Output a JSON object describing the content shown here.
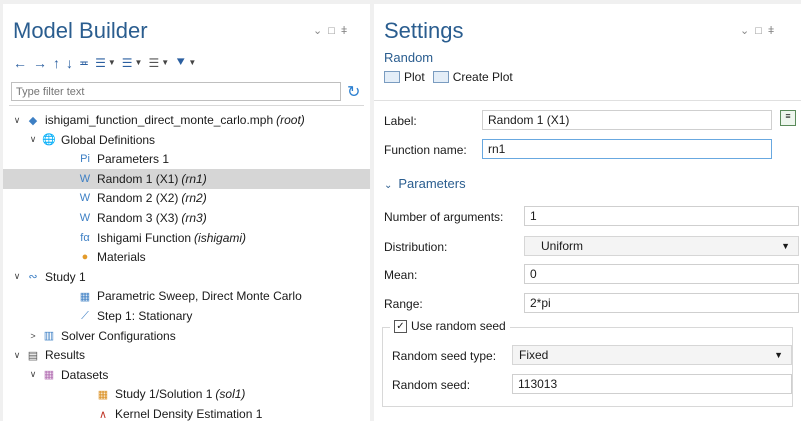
{
  "model_builder": {
    "title": "Model Builder",
    "filter_placeholder": "Type filter text",
    "tree": [
      {
        "label": "ishigami_function_direct_monte_carlo.mph",
        "tag": "(root)",
        "level": 0,
        "twisty": "open",
        "icon": "model-icon"
      },
      {
        "label": "Global Definitions",
        "tag": "",
        "level": 1,
        "twisty": "open",
        "icon": "globe-icon"
      },
      {
        "label": "Parameters 1",
        "tag": "",
        "level": 2,
        "twisty": "none",
        "icon": "parameters-icon"
      },
      {
        "label": "Random 1 (X1)",
        "tag": "(rn1)",
        "level": 2,
        "twisty": "none",
        "icon": "random-function-icon",
        "selected": true
      },
      {
        "label": "Random 2 (X2)",
        "tag": "(rn2)",
        "level": 2,
        "twisty": "none",
        "icon": "random-function-icon"
      },
      {
        "label": "Random 3 (X3)",
        "tag": "(rn3)",
        "level": 2,
        "twisty": "none",
        "icon": "random-function-icon"
      },
      {
        "label": "Ishigami Function",
        "tag": "(ishigami)",
        "level": 2,
        "twisty": "none",
        "icon": "analytic-function-icon"
      },
      {
        "label": "Materials",
        "tag": "",
        "level": 2,
        "twisty": "none",
        "icon": "materials-icon"
      },
      {
        "label": "Study 1",
        "tag": "",
        "level": 0,
        "twisty": "open",
        "icon": "study-icon"
      },
      {
        "label": "Parametric Sweep, Direct Monte Carlo",
        "tag": "",
        "level": 2,
        "twisty": "none",
        "icon": "parametric-sweep-icon"
      },
      {
        "label": "Step 1: Stationary",
        "tag": "",
        "level": 2,
        "twisty": "none",
        "icon": "stationary-step-icon"
      },
      {
        "label": "Solver Configurations",
        "tag": "",
        "level": 1,
        "twisty": "closed",
        "icon": "solver-icon"
      },
      {
        "label": "Results",
        "tag": "",
        "level": 0,
        "twisty": "open",
        "icon": "results-icon"
      },
      {
        "label": "Datasets",
        "tag": "",
        "level": 1,
        "twisty": "open",
        "icon": "datasets-icon"
      },
      {
        "label": "Study 1/Solution 1",
        "tag": "(sol1)",
        "level": 3,
        "twisty": "none",
        "icon": "solution-icon"
      },
      {
        "label": "Kernel Density Estimation 1",
        "tag": "",
        "level": 3,
        "twisty": "none",
        "icon": "kde-icon"
      }
    ]
  },
  "settings": {
    "title": "Settings",
    "subtitle": "Random",
    "plot_label": "Plot",
    "create_plot_label": "Create Plot",
    "label_label": "Label:",
    "label_value": "Random 1 (X1)",
    "function_name_label": "Function name:",
    "function_name_value": "rn1",
    "section_parameters": "Parameters",
    "num_args_label": "Number of arguments:",
    "num_args_value": "1",
    "distribution_label": "Distribution:",
    "distribution_value": "Uniform",
    "mean_label": "Mean:",
    "mean_value": "0",
    "range_label": "Range:",
    "range_value": "2*pi",
    "use_seed_label": "Use random seed",
    "use_seed_checked": true,
    "seed_type_label": "Random seed type:",
    "seed_type_value": "Fixed",
    "seed_label": "Random seed:",
    "seed_value": "113013"
  },
  "colors": {
    "title_blue": "#2a5d8f",
    "selection": "#d6d6d6",
    "random_icon": "#3d7fc4"
  }
}
